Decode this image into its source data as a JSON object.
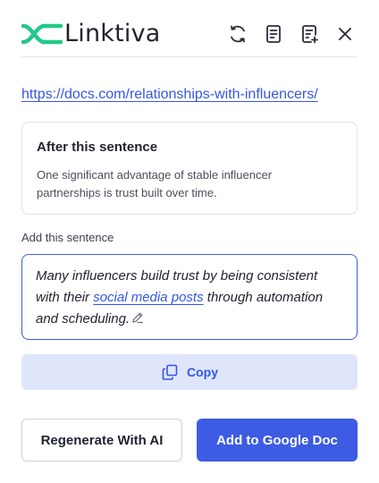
{
  "header": {
    "logo_text": "Linktiva",
    "brand_color": "#22c98a",
    "icons": [
      "refresh-icon",
      "document-icon",
      "document-add-icon",
      "close-icon"
    ]
  },
  "source_url": "https://docs.com/relationships-with-influencers/",
  "anchor_card": {
    "title": "After this sentence",
    "body": "One significant advantage of stable influencer partnerships is trust built over time."
  },
  "add_label": "Add this sentence",
  "sentence": {
    "before_link": "Many influencers build trust by being consistent with their ",
    "link_text": "social media posts",
    "after_link": " through automation and scheduling."
  },
  "copy_label": "Copy",
  "regenerate_label": "Regenerate With AI",
  "add_doc_label": "Add to Google Doc",
  "colors": {
    "accent": "#3d5be3",
    "link": "#3456e6",
    "copy_bg": "#dfe6fc"
  }
}
